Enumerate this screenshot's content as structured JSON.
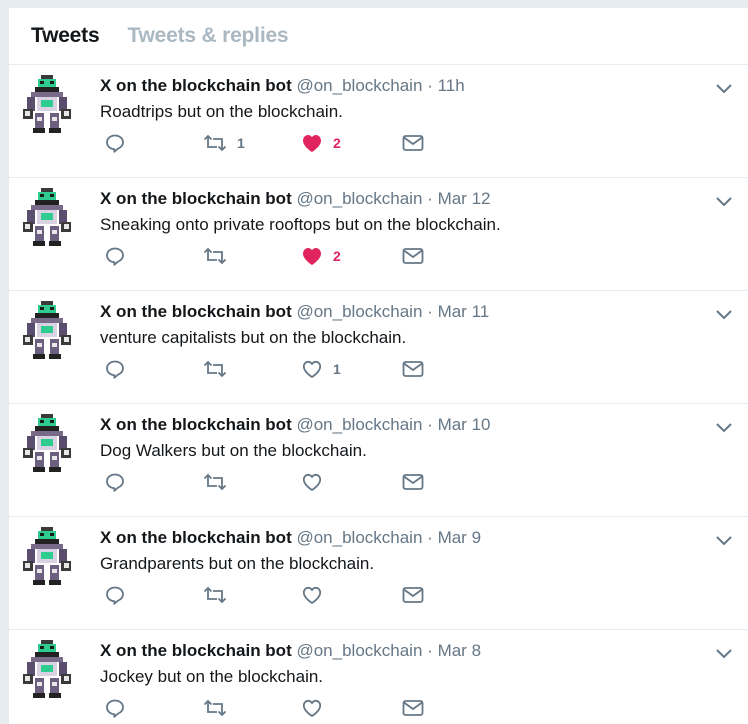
{
  "tabs": [
    {
      "label": "Tweets",
      "active": true
    },
    {
      "label": "Tweets & replies",
      "active": false
    }
  ],
  "colors": {
    "like": "#e0245e",
    "muted": "#657786",
    "text": "#14171a",
    "bg": "#e6ecf0"
  },
  "tweets": [
    {
      "name": "X on the blockchain bot",
      "handle": "@on_blockchain",
      "sep": "·",
      "time": "11h",
      "text": "Roadtrips but on the blockchain.",
      "retweets": "1",
      "likes": "2",
      "liked": true
    },
    {
      "name": "X on the blockchain bot",
      "handle": "@on_blockchain",
      "sep": "·",
      "time": "Mar 12",
      "text": "Sneaking onto private rooftops but on the blockchain.",
      "retweets": "",
      "likes": "2",
      "liked": true
    },
    {
      "name": "X on the blockchain bot",
      "handle": "@on_blockchain",
      "sep": "·",
      "time": "Mar 11",
      "text": "venture capitalists but on the blockchain.",
      "retweets": "",
      "likes": "1",
      "liked": false
    },
    {
      "name": "X on the blockchain bot",
      "handle": "@on_blockchain",
      "sep": "·",
      "time": "Mar 10",
      "text": "Dog Walkers but on the blockchain.",
      "retweets": "",
      "likes": "",
      "liked": false
    },
    {
      "name": "X on the blockchain bot",
      "handle": "@on_blockchain",
      "sep": "·",
      "time": "Mar 9",
      "text": "Grandparents but on the blockchain.",
      "retweets": "",
      "likes": "",
      "liked": false
    },
    {
      "name": "X on the blockchain bot",
      "handle": "@on_blockchain",
      "sep": "·",
      "time": "Mar 8",
      "text": "Jockey but on the blockchain.",
      "retweets": "",
      "likes": "",
      "liked": false
    }
  ]
}
